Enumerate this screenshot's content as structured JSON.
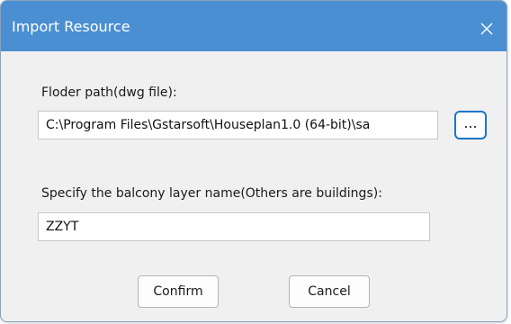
{
  "window": {
    "title": "Import Resource",
    "close_icon": "close-icon"
  },
  "folder_path": {
    "label": "Floder path(dwg file):",
    "value": "C:\\Program Files\\Gstarsoft\\Houseplan1.0 (64-bit)\\sa",
    "browse_label": "..."
  },
  "balcony_layer": {
    "label": "Specify the balcony layer name(Others are buildings):",
    "value": "ZZYT"
  },
  "buttons": {
    "confirm": "Confirm",
    "cancel": "Cancel"
  },
  "colors": {
    "titlebar": "#4a8fd2",
    "dialog_bg": "#f0f0f0",
    "focus_border": "#1e73c8"
  }
}
